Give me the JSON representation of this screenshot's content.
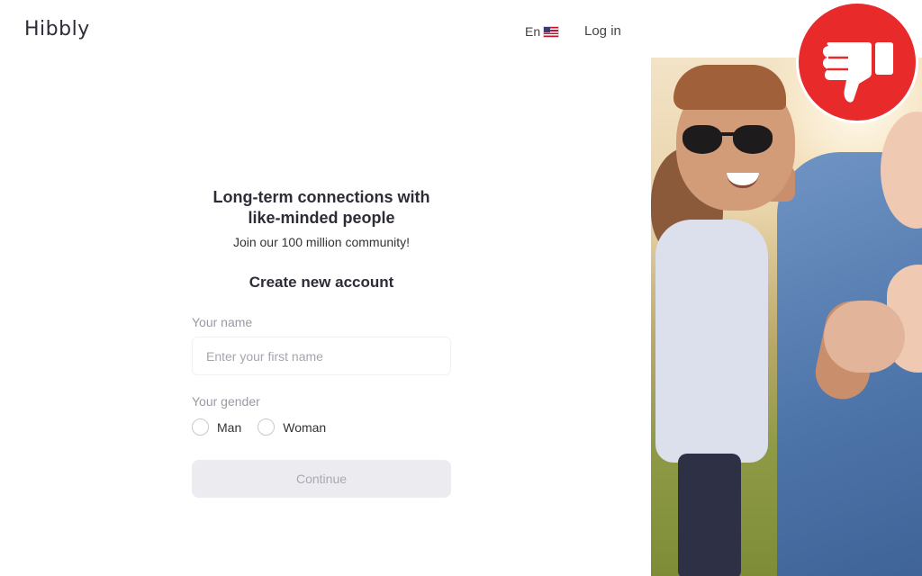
{
  "header": {
    "logo": "Hibbly",
    "language": "En",
    "login_label": "Log in"
  },
  "hero": {
    "headline_line1": "Long-term connections with",
    "headline_line2": "like-minded people",
    "subline": "Join our 100 million community!"
  },
  "form": {
    "title": "Create new account",
    "name_label": "Your name",
    "name_placeholder": "Enter your first name",
    "name_value": "",
    "gender_label": "Your gender",
    "gender_options": [
      "Man",
      "Woman"
    ],
    "continue_label": "Continue"
  },
  "icons": {
    "language_flag": "us-flag-icon",
    "badge": "thumbs-down-icon"
  },
  "colors": {
    "badge_red": "#e82a2b",
    "button_disabled_bg": "#ececf0",
    "label_gray": "#9a9aa4"
  }
}
